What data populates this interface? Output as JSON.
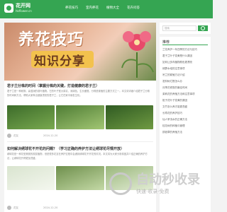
{
  "header": {
    "logo_cn": "花开网",
    "logo_en": "hkflower.cn",
    "nav": [
      "养花技巧",
      "室内养花",
      "植物大全",
      "花卉问答"
    ]
  },
  "hero": {
    "title": "养花技巧",
    "subtitle": "知识分享"
  },
  "posts": [
    {
      "title": "君子兰分株的时间（掌握分株的关键，打造健康的君子兰）",
      "excerpt": "君子兰是一种耐阴、喜湿润的观叶植物。它的叶子宽大厚实，深绿色，生长缓慢，分株是繁殖的主要方式之一。本文将详细介绍君子兰分株的时间和方法，帮助大家养出健康漂亮的君子兰，让它在家中焕发生机。",
      "author": "花友",
      "date": "2024-12-20"
    },
    {
      "title": "如何解决绣球花不开花的问题？（学习正确的养护方法让绣球花尽情开放）",
      "excerpt": "绣球花是一种花型美丽的观赏植物，但是很多花友在养护过程中会遇到绣球花不开花的情况。本文将为大家分析原因并介绍正确的养护方法，让绣球花开得更加茂盛。",
      "author": "花友",
      "date": "2024-12-20"
    }
  ],
  "sidebar": {
    "search_placeholder": "搜索",
    "heading": "推荐",
    "items": [
      "兰花养护一年四季的方法与技巧",
      "君子兰叶子发黄是什么原因",
      "如何让多肉植物颜色更漂亮",
      "绿萝水培的注意事项",
      "吊兰的繁殖方法介绍",
      "发财树烂根怎么办",
      "月季花修剪的最佳时间",
      "茉莉花的养殖方法和注意事项",
      "栀子花叶子发黄的原因",
      "文竹怎么养才能更茂盛",
      "长寿花的养护技巧",
      "仙人掌浇水的正确方法",
      "桂花树的种植与管理",
      "铜钱草的养殖方法"
    ]
  },
  "watermark": {
    "title": "自动秒收录",
    "subtitle": "快速·收录·免费"
  }
}
